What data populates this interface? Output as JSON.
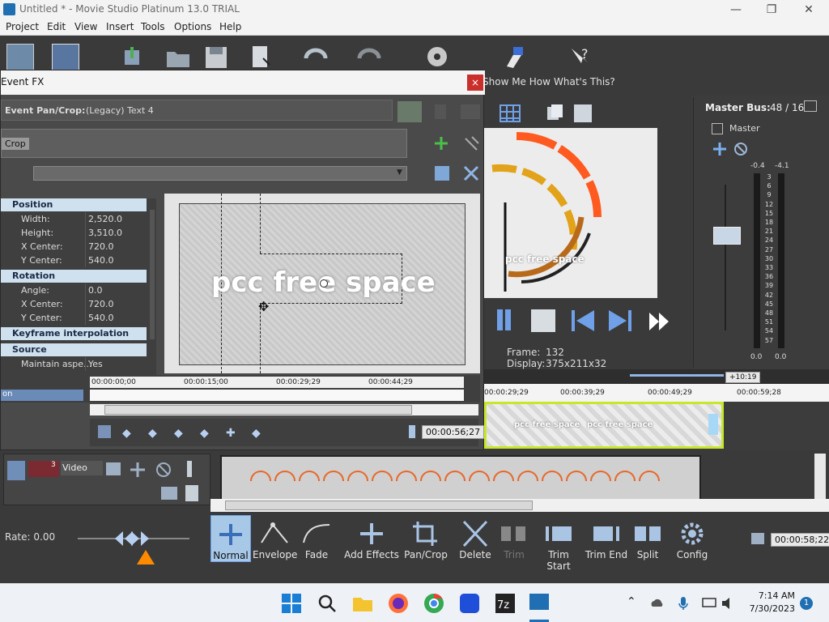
{
  "window": {
    "title": "Untitled * - Movie Studio Platinum 13.0 TRIAL",
    "minimize": "—",
    "restore": "❐",
    "close": "✕"
  },
  "menu": [
    "Project",
    "Edit",
    "View",
    "Insert",
    "Tools",
    "Options",
    "Help"
  ],
  "toolbar": {
    "show_me_how": "Show Me How",
    "whats_this": "What's This?"
  },
  "dialog": {
    "title": "Event FX",
    "close": "×",
    "header": "Event Pan/Crop:",
    "header_value": "(Legacy) Text 4",
    "crop_tab": "Crop",
    "preview_text": "pcc free space",
    "sections": [
      {
        "name": "Position",
        "rows": [
          [
            "Width:",
            "2,520.0"
          ],
          [
            "Height:",
            "3,510.0"
          ],
          [
            "X Center:",
            "720.0"
          ],
          [
            "Y Center:",
            "540.0"
          ]
        ]
      },
      {
        "name": "Rotation",
        "rows": [
          [
            "Angle:",
            "0.0"
          ],
          [
            "X Center:",
            "720.0"
          ],
          [
            "Y Center:",
            "540.0"
          ]
        ]
      },
      {
        "name": "Keyframe interpolation",
        "rows": []
      },
      {
        "name": "Source",
        "rows": [
          [
            "Maintain aspe...",
            "Yes"
          ]
        ]
      }
    ],
    "ruler": [
      "00:00:00;00",
      "00:00:15;00",
      "00:00:29;29",
      "00:00:44;29"
    ],
    "track_label": "on",
    "end_time": "00:00:56;27"
  },
  "preview": {
    "frame_label": "Frame:",
    "frame_value": "132",
    "display_label": "Display:",
    "display_value": "375x211x32",
    "overlay_text": "pcc free space"
  },
  "master": {
    "title": "Master Bus:",
    "channels": "48 / 16",
    "name": "Master",
    "peak_left": "-0.4",
    "peak_right": "-4.1",
    "scale": [
      "3",
      "6",
      "9",
      "12",
      "15",
      "18",
      "21",
      "24",
      "27",
      "30",
      "33",
      "36",
      "39",
      "42",
      "45",
      "48",
      "51",
      "54",
      "57"
    ],
    "bottom_left": "0.0",
    "bottom_right": "0.0"
  },
  "timeline": {
    "offset": "+10:19",
    "ruler": [
      "00:00:29;29",
      "00:00:39;29",
      "00:00:49;29",
      "00:00:59;28"
    ],
    "clip_text": "pcc free space",
    "track_name": "Video",
    "track_number": "3"
  },
  "rate": {
    "label": "Rate: 0.00"
  },
  "tools": [
    "Normal",
    "Envelope",
    "Fade",
    "Add Effects",
    "Pan/Crop",
    "Delete",
    "Trim",
    "Trim Start",
    "Trim End",
    "Split",
    "Config"
  ],
  "status_time": "00:00:58;22",
  "taskbar": {
    "time": "7:14 AM",
    "date": "7/30/2023",
    "notifications": "1"
  },
  "colors": {
    "accent": "#3c78c8",
    "selection": "#a8c8e8",
    "clip": "#c7e82a"
  }
}
